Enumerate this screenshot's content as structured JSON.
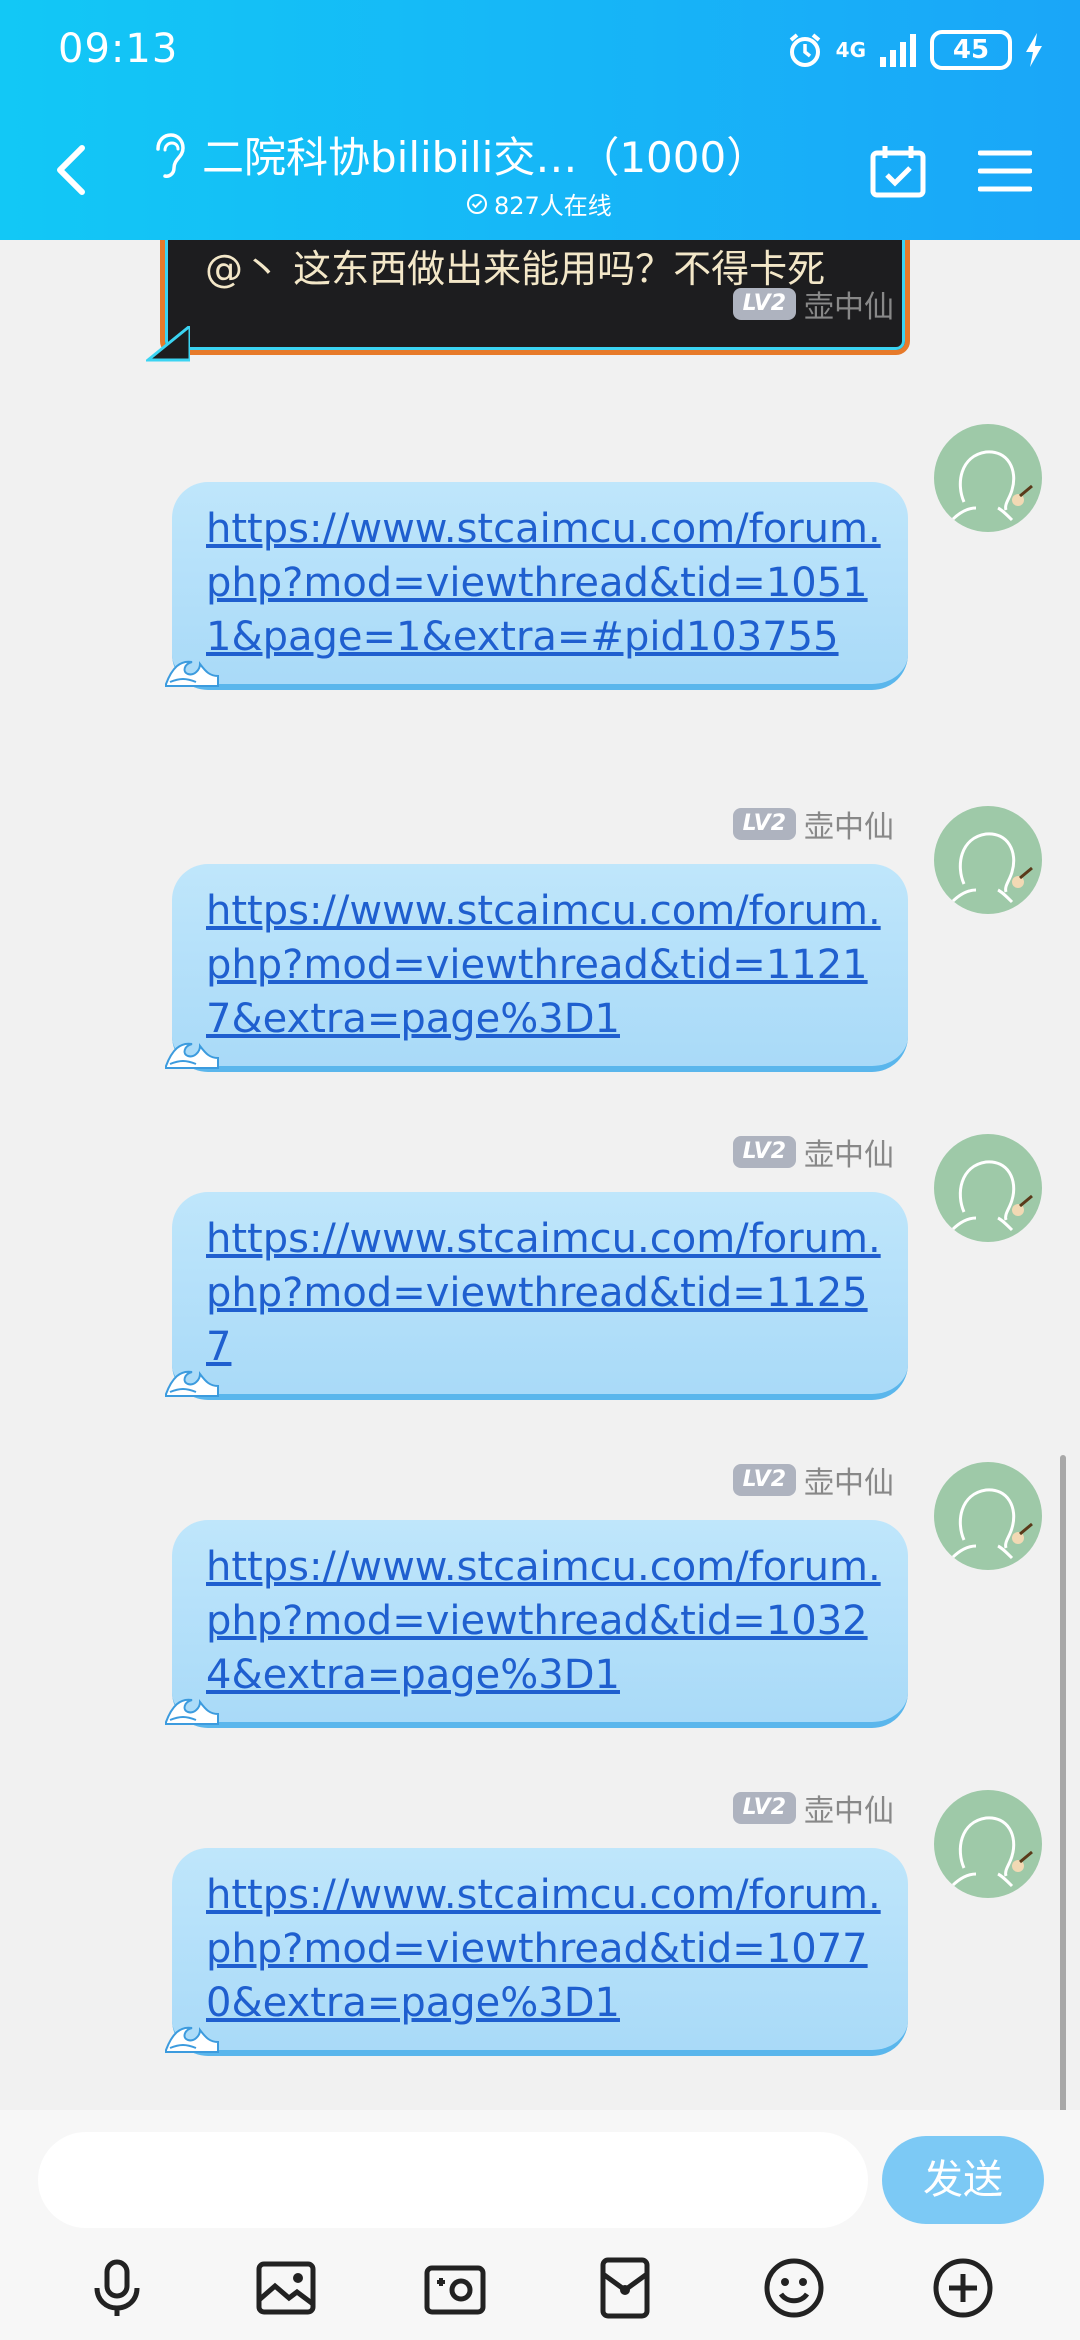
{
  "status_bar": {
    "time": "09:13",
    "network": "4G",
    "battery": "45"
  },
  "header": {
    "title": "二院科协bilibili交…（1000）",
    "online_count": "827人在线"
  },
  "previous_message": {
    "text": "@丶 这东西做出来能用吗？不得卡死"
  },
  "messages": [
    {
      "level": "LV2",
      "sender": "壶中仙",
      "text": "https://www.stcaimcu.com/forum.php?mod=viewthread&tid=10511&page=1&extra=#pid103755"
    },
    {
      "level": "LV2",
      "sender": "壶中仙",
      "text": "https://www.stcaimcu.com/forum.php?mod=viewthread&tid=11217&extra=page%3D1"
    },
    {
      "level": "LV2",
      "sender": "壶中仙",
      "text": "https://www.stcaimcu.com/forum.php?mod=viewthread&tid=11257"
    },
    {
      "level": "LV2",
      "sender": "壶中仙",
      "text": "https://www.stcaimcu.com/forum.php?mod=viewthread&tid=10324&extra=page%3D1"
    },
    {
      "level": "LV2",
      "sender": "壶中仙",
      "text": "https://www.stcaimcu.com/forum.php?mod=viewthread&tid=10770&extra=page%3D1"
    }
  ],
  "composer": {
    "send_label": "发送"
  },
  "colors": {
    "header_start": "#12c8f6",
    "header_end": "#1aa6f8",
    "bubble": "#bfe6fb",
    "link": "#1f5fcf",
    "send": "#7cc9f5"
  }
}
